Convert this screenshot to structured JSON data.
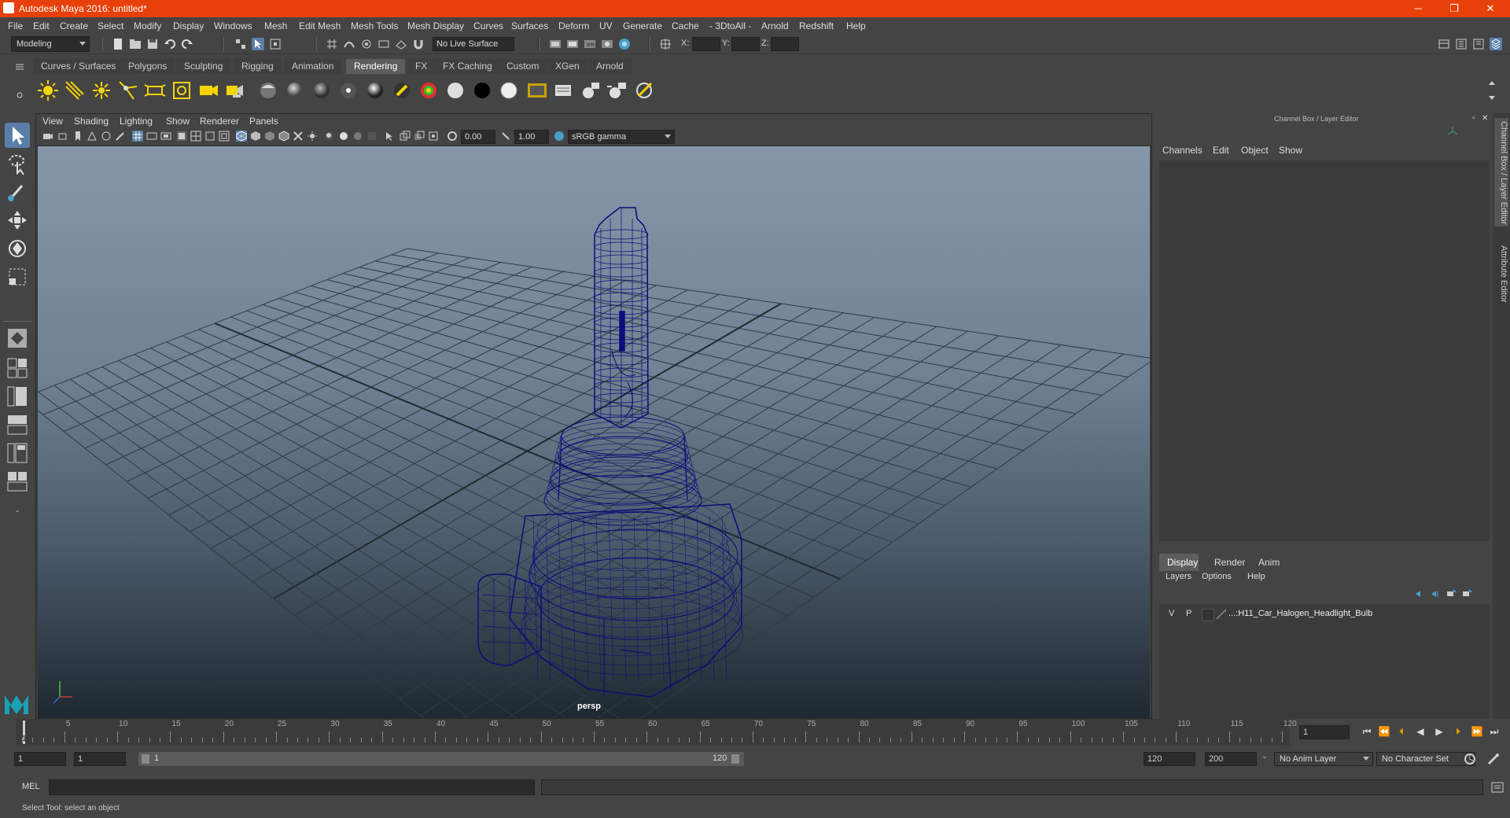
{
  "window": {
    "title": "Autodesk Maya 2016: untitled*",
    "minimize": "─",
    "restore": "❐",
    "close": "✕"
  },
  "menubar": [
    "File",
    "Edit",
    "Create",
    "Select",
    "Modify",
    "Display",
    "Windows",
    "Mesh",
    "Edit Mesh",
    "Mesh Tools",
    "Mesh Display",
    "Curves",
    "Surfaces",
    "Deform",
    "UV",
    "Generate",
    "Cache",
    "- 3DtoAll -",
    "Arnold",
    "Redshift",
    "Help"
  ],
  "statusline": {
    "mode": "Modeling",
    "live_surface": "No Live Surface",
    "x_label": "X:",
    "y_label": "Y:",
    "z_label": "Z:"
  },
  "shelf": {
    "tabs": [
      "Curves / Surfaces",
      "Polygons",
      "Sculpting",
      "Rigging",
      "Animation",
      "Rendering",
      "FX",
      "FX Caching",
      "Custom",
      "XGen",
      "Arnold"
    ],
    "active_tab": "Rendering"
  },
  "viewport": {
    "menu": [
      "View",
      "Shading",
      "Lighting",
      "Show",
      "Renderer",
      "Panels"
    ],
    "exposure": "0.00",
    "gamma": "1.00",
    "color_space": "sRGB gamma",
    "camera_label": "persp"
  },
  "channel_box": {
    "title": "Channel Box / Layer Editor",
    "menu": [
      "Channels",
      "Edit",
      "Object",
      "Show"
    ],
    "layer_tabs": [
      "Display",
      "Render",
      "Anim"
    ],
    "active_layer_tab": "Display",
    "layer_menu": [
      "Layers",
      "Options",
      "Help"
    ],
    "layer": {
      "v": "V",
      "p": "P",
      "name": "...:H11_Car_Halogen_Headlight_Bulb"
    }
  },
  "side_tabs": [
    "Channel Box / Layer Editor",
    "Attribute Editor"
  ],
  "timeline": {
    "ticks": [
      5,
      10,
      15,
      20,
      25,
      30,
      35,
      40,
      45,
      50,
      55,
      60,
      65,
      70,
      75,
      80,
      85,
      90,
      95,
      100,
      105,
      110,
      115,
      120
    ],
    "current_frame_marker": "1",
    "current_frame_field": "1"
  },
  "range": {
    "start": "1",
    "inner_start": "1",
    "slider_start": "1",
    "slider_end": "120",
    "end": "120",
    "max": "200",
    "anim_layer": "No Anim Layer",
    "character_set": "No Character Set"
  },
  "command": {
    "label": "MEL"
  },
  "help_line": "Select Tool: select an object"
}
